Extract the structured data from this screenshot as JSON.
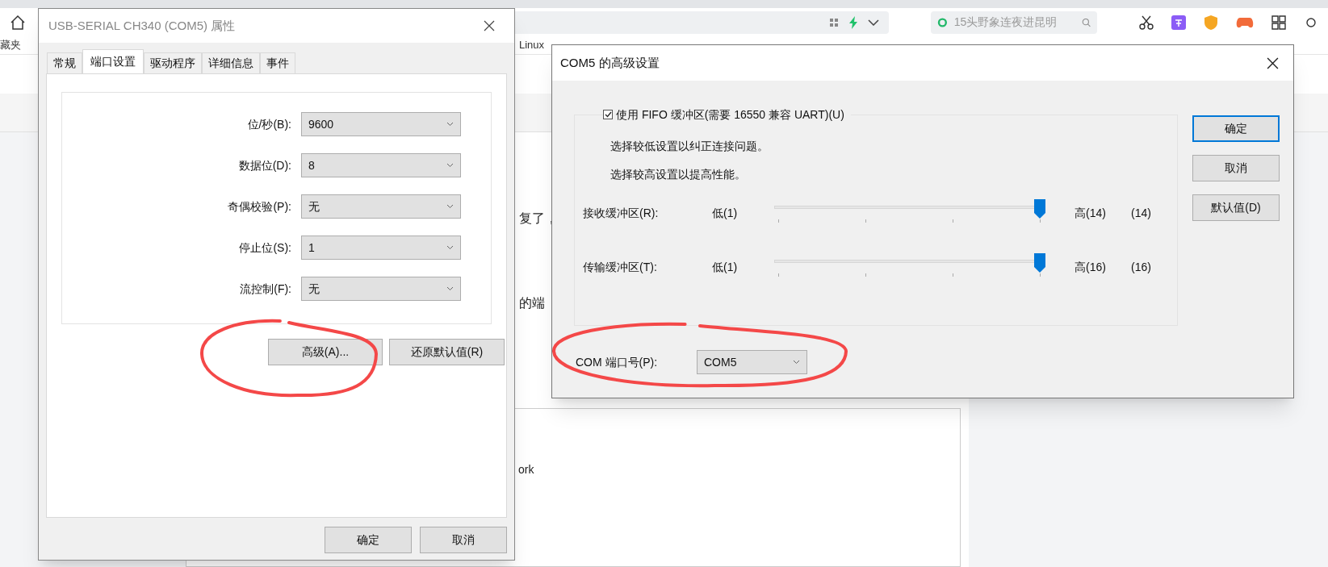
{
  "browser": {
    "search": {
      "placeholder": "15头野象连夜进昆明"
    },
    "bookmarks": [
      "藏夹",
      "Linux"
    ],
    "page_fragments": [
      "复了，",
      "的端",
      "ork"
    ]
  },
  "properties_dialog": {
    "title": "USB-SERIAL CH340 (COM5) 属性",
    "tabs": [
      {
        "label": "常规",
        "selected": false
      },
      {
        "label": "端口设置",
        "selected": true
      },
      {
        "label": "驱动程序",
        "selected": false
      },
      {
        "label": "详细信息",
        "selected": false
      },
      {
        "label": "事件",
        "selected": false
      }
    ],
    "fields": [
      {
        "label": "位/秒(B):",
        "value": "9600"
      },
      {
        "label": "数据位(D):",
        "value": "8"
      },
      {
        "label": "奇偶校验(P):",
        "value": "无"
      },
      {
        "label": "停止位(S):",
        "value": "1"
      },
      {
        "label": "流控制(F):",
        "value": "无"
      }
    ],
    "buttons": [
      "高级(A)...",
      "还原默认值(R)"
    ],
    "footer_buttons": [
      "确定",
      "取消"
    ]
  },
  "advanced_dialog": {
    "title": "COM5 的高级设置",
    "fifo": {
      "label": "使用 FIFO 缓冲区(需要 16550 兼容 UART)(U)",
      "checked": true
    },
    "hints": [
      "选择较低设置以纠正连接问题。",
      "选择较高设置以提高性能。"
    ],
    "sliders": [
      {
        "label": "接收缓冲区(R):",
        "min_label": "低(1)",
        "max_label": "高(14)",
        "reading": "(14)",
        "level": 1
      },
      {
        "label": "传输缓冲区(T):",
        "min_label": "低(1)",
        "max_label": "高(16)",
        "reading": "(16)",
        "level": 1
      }
    ],
    "port": {
      "label": "COM 端口号(P):",
      "value": "COM5"
    },
    "buttons": [
      {
        "label": "确定",
        "default": true
      },
      {
        "label": "取消",
        "default": false
      },
      {
        "label": "默认值(D)",
        "default": false
      }
    ]
  }
}
